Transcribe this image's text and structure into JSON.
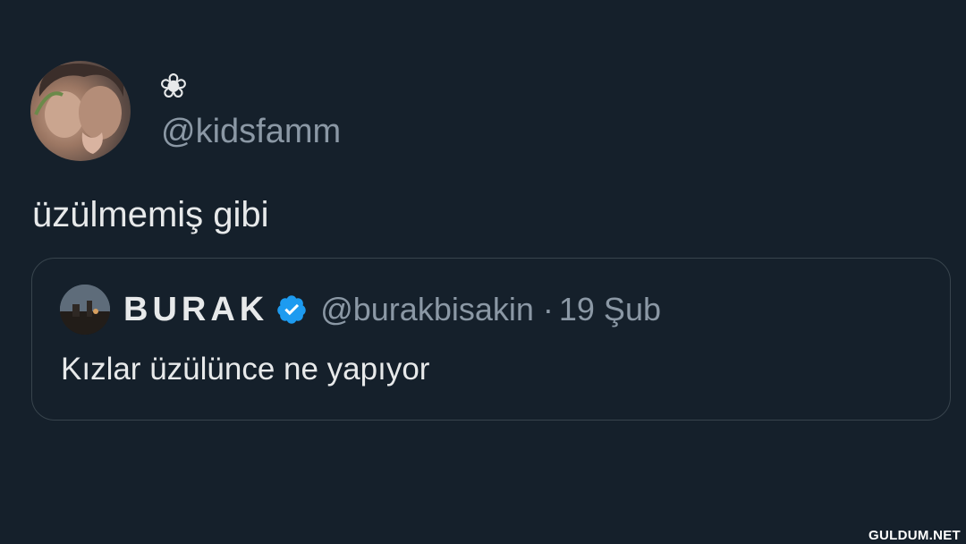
{
  "tweet": {
    "display_name": "❀",
    "handle": "@kidsfamm",
    "text": "üzülmemiş gibi",
    "avatar_icon": "profile-photo"
  },
  "quoted_tweet": {
    "display_name": "BURAK",
    "verified_icon": "verified-badge-icon",
    "handle": "@burakbisakin",
    "separator": "·",
    "date": "19 Şub",
    "text": "Kızlar üzülünce ne yapıyor"
  },
  "watermark": {
    "text": "GULDUM.NET"
  },
  "colors": {
    "background": "#15202b",
    "primary_text": "#e7e9ea",
    "secondary_text": "#8b98a5",
    "border": "#38444d",
    "verified_blue": "#1d9bf0"
  }
}
